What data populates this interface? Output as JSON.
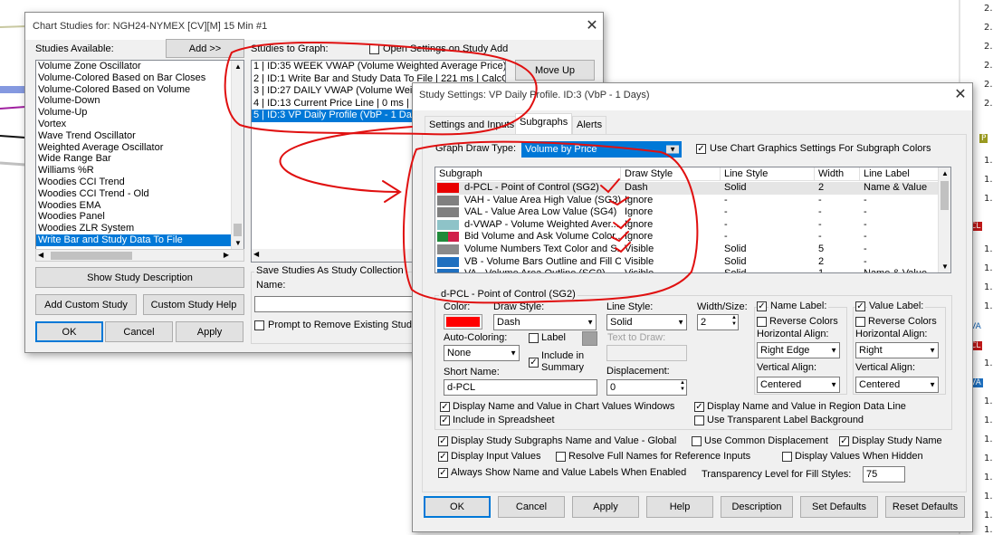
{
  "background": {
    "axis_labels": [
      "2.",
      "2.",
      "2.",
      "2.",
      "2.",
      "2.",
      "1.",
      "1.",
      "1.",
      "1.",
      "1.",
      "1.",
      "1.",
      "1.",
      "1.",
      "1.",
      "1.",
      "1.",
      "1.",
      "1.",
      "1.",
      "1."
    ],
    "tags": {
      "p": "P",
      "cl": "CL",
      "va1": "VA",
      "cl2": "CL",
      "va2": "VA"
    }
  },
  "chart_studies": {
    "title": "Chart Studies for: NGH24-NYMEX [CV][M]  15 Min  #1",
    "close": "✕",
    "studies_available_label": "Studies Available:",
    "add_button": "Add >>",
    "studies_available": [
      "Volume Zone Oscillator",
      "Volume-Colored Based on Bar Closes",
      "Volume-Colored Based on Volume",
      "Volume-Down",
      "Volume-Up",
      "Vortex",
      "Wave Trend Oscillator",
      "Weighted Average Oscillator",
      "Wide Range Bar",
      "Williams %R",
      "Woodies CCI Trend",
      "Woodies CCI Trend - Old",
      "Woodies EMA",
      "Woodies Panel",
      "Woodies ZLR System",
      "Write Bar and Study Data To File"
    ],
    "studies_to_graph_label": "Studies to Graph:",
    "open_settings_label": "Open Settings on Study Add",
    "studies_to_graph": [
      "1 | ID:35  WEEK VWAP (Volume Weighted Average Price) |",
      "2 | ID:1  Write Bar and Study Data To File | 221 ms | CalcOrd",
      "3 | ID:27  DAILY VWAP (Volume Weig",
      "4 | ID:13  Current Price Line | 0 ms | Ca",
      "5 | ID:3  VP Daily Profile (VbP - 1 Day"
    ],
    "move_up_button": "Move Up",
    "show_description_button": "Show Study Description",
    "add_custom_button": "Add Custom Study",
    "custom_help_button": "Custom Study Help",
    "ok_button": "OK",
    "cancel_button": "Cancel",
    "apply_button": "Apply",
    "save_collection_label": "Save Studies As Study Collection",
    "name_label": "Name:",
    "prompt_remove_label": "Prompt to Remove Existing Studie"
  },
  "study_settings": {
    "title": "Study Settings: VP Daily Profile. ID:3 (VbP - 1 Days)",
    "close": "✕",
    "tabs": [
      "Settings and Inputs",
      "Subgraphs",
      "Alerts"
    ],
    "graph_draw_type_label": "Graph Draw Type:",
    "graph_draw_type_value": "Volume by Price",
    "use_chart_graphics_label": "Use Chart Graphics Settings For Subgraph Colors",
    "grid_headers": [
      "Subgraph",
      "Draw Style",
      "Line Style",
      "Width",
      "Line Label"
    ],
    "grid_rows": [
      {
        "color": "#e80000",
        "color2": "#e80000",
        "name": "d-PCL - Point of Control (SG2)",
        "draw": "Dash",
        "line": "Solid",
        "width": "2",
        "label": "Name & Value"
      },
      {
        "color": "#808080",
        "color2": "#808080",
        "name": "VAH - Value Area High Value (SG3)",
        "draw": "Ignore",
        "line": "-",
        "width": "-",
        "label": "-"
      },
      {
        "color": "#808080",
        "color2": "#808080",
        "name": "VAL - Value Area Low Value (SG4)",
        "draw": "Ignore",
        "line": "-",
        "width": "-",
        "label": "-"
      },
      {
        "color": "#8ec3c8",
        "color2": "#8ec3c8",
        "name": "d-VWAP - Volume Weighted Aver...",
        "draw": "Ignore",
        "line": "-",
        "width": "-",
        "label": "-"
      },
      {
        "color": "#1f8a3a",
        "color2": "#d0204a",
        "name": "Bid Volume and Ask Volume Color...",
        "draw": "Ignore",
        "line": "-",
        "width": "-",
        "label": "-"
      },
      {
        "color": "#8a8a8a",
        "color2": "#8a8a8a",
        "name": "Volume Numbers Text Color and S...",
        "draw": "Visible",
        "line": "Solid",
        "width": "5",
        "label": "-"
      },
      {
        "color": "#1e6fbf",
        "color2": "#1e6fbf",
        "name": "VB - Volume Bars Outline and Fill C...",
        "draw": "Visible",
        "line": "Solid",
        "width": "2",
        "label": "-"
      },
      {
        "color": "#1e6fbf",
        "color2": "#1e6fbf",
        "name": "VA - Volume Area Outline (SG9)",
        "draw": "Visible",
        "line": "Solid",
        "width": "1",
        "label": "Name & Value"
      }
    ],
    "detail_group_title": "d-PCL - Point of Control (SG2)",
    "color_label": "Color:",
    "color_value": "#ff0000",
    "draw_style_label": "Draw Style:",
    "draw_style_value": "Dash",
    "line_style_label": "Line Style:",
    "line_style_value": "Solid",
    "width_label": "Width/Size:",
    "width_value": "2",
    "name_label_label": "Name Label:",
    "value_label_label": "Value Label:",
    "reverse_colors": "Reverse Colors",
    "horizontal_align": "Horizontal Align:",
    "name_h_align": "Right Edge",
    "value_h_align": "Right",
    "vertical_align": "Vertical Align:",
    "name_v_align": "Centered",
    "value_v_align": "Centered",
    "auto_coloring_label": "Auto-Coloring:",
    "auto_coloring_value": "None",
    "label_checkbox": "Label",
    "include_summary": "Include in Summary",
    "text_to_draw_label": "Text to Draw:",
    "short_name_label": "Short Name:",
    "short_name_value": "d-PCL",
    "displacement_label": "Displacement:",
    "displacement_value": "0",
    "display_name_chart_values": "Display Name and Value in Chart Values Windows",
    "display_name_region": "Display Name and Value in Region Data Line",
    "include_spreadsheet": "Include in Spreadsheet",
    "use_transparent_bg": "Use Transparent Label Background",
    "display_subgraphs_global": "Display Study Subgraphs Name and Value - Global",
    "use_common_displacement": "Use Common Displacement",
    "display_study_name": "Display Study Name",
    "display_input_values": "Display Input Values",
    "resolve_full_names": "Resolve Full Names for Reference Inputs",
    "display_values_hidden": "Display Values When Hidden",
    "always_show_labels": "Always Show Name and Value Labels When Enabled",
    "transparency_label": "Transparency Level for Fill Styles:",
    "transparency_value": "75",
    "buttons": [
      "OK",
      "Cancel",
      "Apply",
      "Help",
      "Description",
      "Set Defaults",
      "Reset Defaults"
    ]
  },
  "colors": {
    "selection": "#0078d7",
    "annotation": "#e01010"
  }
}
